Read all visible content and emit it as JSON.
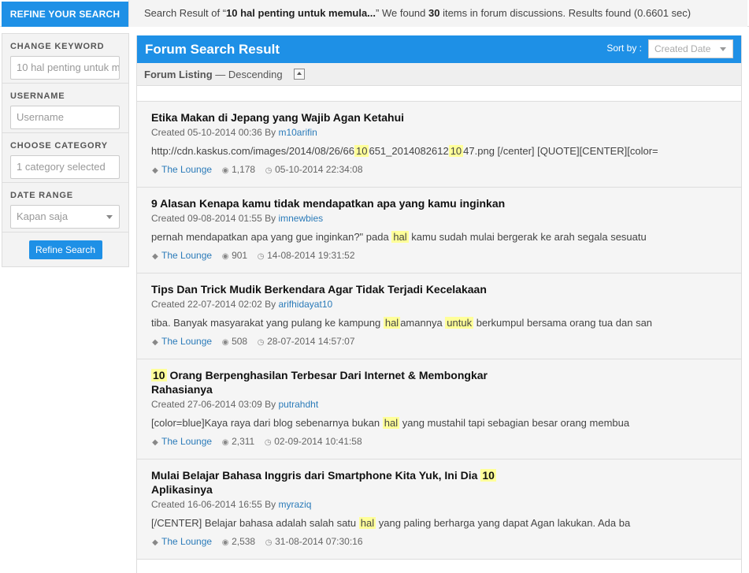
{
  "refine_tab": "REFINE YOUR SEARCH",
  "summary": {
    "prefix": "Search Result of “",
    "query": "10 hal penting untuk memula...",
    "middle": "” We found ",
    "count": "30",
    "suffix": " items in forum discussions. Results found (0.6601 sec)"
  },
  "sidebar": {
    "keyword_label": "CHANGE KEYWORD",
    "keyword_value": "10 hal penting untuk m",
    "username_label": "USERNAME",
    "username_placeholder": "Username",
    "category_label": "CHOOSE CATEGORY",
    "category_value": "1 category selected",
    "daterange_label": "DATE RANGE",
    "daterange_value": "Kapan saja",
    "refine_button": "Refine Search"
  },
  "main": {
    "title": "Forum Search Result",
    "sort_label": "Sort by :",
    "sort_value": "Created Date",
    "listing_label": "Forum Listing",
    "listing_dash": " — ",
    "listing_order": "Descending"
  },
  "results": [
    {
      "title": [
        {
          "t": "Etika Makan di Jepang yang Wajib Agan Ketahui"
        }
      ],
      "created": "Created 05-10-2014 00:36 By ",
      "author": "m10arifin",
      "snippet": [
        {
          "t": "http://cdn.kaskus.com/images/2014/08/26/66"
        },
        {
          "t": "10",
          "h": true
        },
        {
          "t": "651_2014082612"
        },
        {
          "t": "10",
          "h": true
        },
        {
          "t": "47.png [/center] [QUOTE][CENTER][color="
        }
      ],
      "category": "The Lounge",
      "views": "1,178",
      "date": "05-10-2014 22:34:08"
    },
    {
      "title": [
        {
          "t": "9 Alasan Kenapa kamu tidak mendapatkan apa yang kamu inginkan"
        }
      ],
      "created": "Created 09-08-2014 01:55 By ",
      "author": "imnewbies",
      "snippet": [
        {
          "t": "pernah mendapatkan apa yang gue inginkan?\" pada "
        },
        {
          "t": "hal",
          "h": true
        },
        {
          "t": " kamu sudah mulai bergerak ke arah segala sesuatu"
        }
      ],
      "category": "The Lounge",
      "views": "901",
      "date": "14-08-2014 19:31:52"
    },
    {
      "title": [
        {
          "t": "Tips Dan Trick Mudik Berkendara Agar Tidak Terjadi Kecelakaan"
        }
      ],
      "created": "Created 22-07-2014 02:02 By ",
      "author": "arifhidayat10",
      "snippet": [
        {
          "t": "tiba. Banyak masyarakat yang pulang ke kampung "
        },
        {
          "t": "hal",
          "h": true
        },
        {
          "t": "amannya "
        },
        {
          "t": "untuk",
          "h": true
        },
        {
          "t": " berkumpul bersama orang tua dan san"
        }
      ],
      "category": "The Lounge",
      "views": "508",
      "date": "28-07-2014 14:57:07"
    },
    {
      "title": [
        {
          "t": "10",
          "h": true
        },
        {
          "t": " Orang Berpenghasilan Terbesar Dari Internet & Membongkar Rahasianya"
        }
      ],
      "created": "Created 27-06-2014 03:09 By ",
      "author": "putrahdht",
      "snippet": [
        {
          "t": "[color=blue]Kaya raya dari blog sebenarnya bukan "
        },
        {
          "t": "hal",
          "h": true
        },
        {
          "t": " yang mustahil tapi sebagian besar orang membua"
        }
      ],
      "category": "The Lounge",
      "views": "2,311",
      "date": "02-09-2014 10:41:58"
    },
    {
      "title": [
        {
          "t": "Mulai Belajar Bahasa Inggris dari Smartphone Kita Yuk, Ini Dia "
        },
        {
          "t": "10",
          "h": true
        },
        {
          "t": " Aplikasinya"
        }
      ],
      "created": "Created 16-06-2014 16:55 By ",
      "author": "myraziq",
      "snippet": [
        {
          "t": "[/CENTER] Belajar bahasa adalah salah satu "
        },
        {
          "t": "hal",
          "h": true
        },
        {
          "t": " yang paling berharga yang dapat Agan lakukan. Ada ba"
        }
      ],
      "category": "The Lounge",
      "views": "2,538",
      "date": "31-08-2014 07:30:16"
    }
  ]
}
